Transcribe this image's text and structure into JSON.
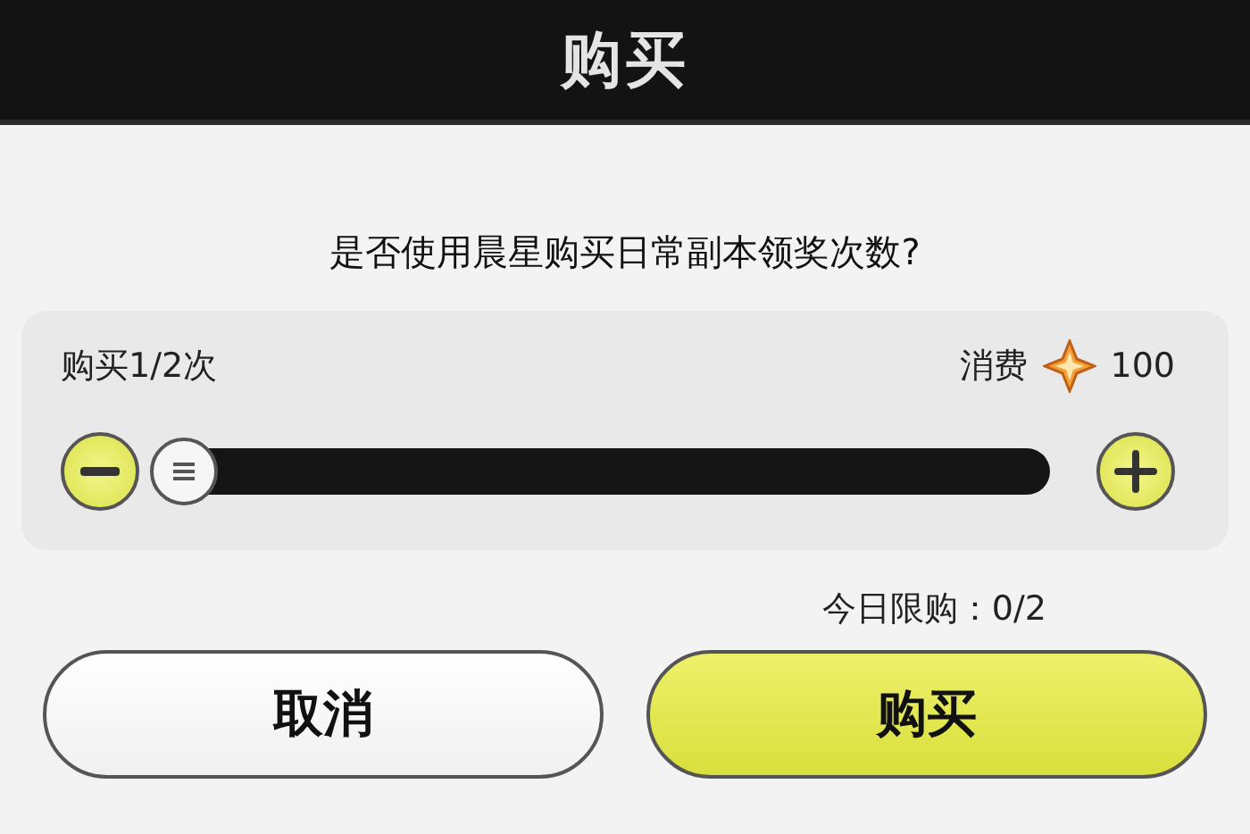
{
  "dialog": {
    "title": "购买",
    "question": "是否使用晨星购买日常副本领奖次数?"
  },
  "purchase": {
    "count_label": "购买1/2次",
    "cost_label": "消费",
    "cost_value": "100",
    "slider": {
      "level": 0
    }
  },
  "daily_limit": "今日限购：0/2",
  "buttons": [
    {
      "label": "取消",
      "kind": "secondary"
    },
    {
      "label": "购买",
      "kind": "primary"
    }
  ]
}
